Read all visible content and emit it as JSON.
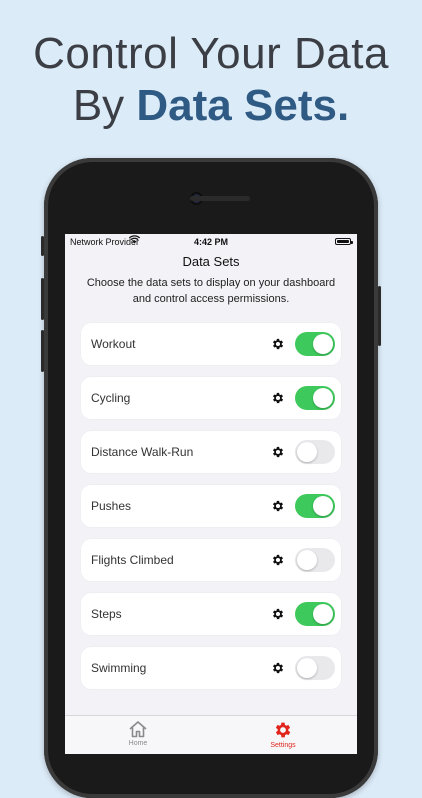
{
  "promo": {
    "line1": "Control Your Data",
    "line2_prefix": "By ",
    "line2_accent": "Data Sets."
  },
  "status_bar": {
    "carrier": "Network Provider",
    "time": "4:42 PM"
  },
  "screen": {
    "title": "Data Sets",
    "description": "Choose the data sets to display on your dashboard and control access permissions."
  },
  "data_sets": [
    {
      "label": "Workout",
      "enabled": true
    },
    {
      "label": "Cycling",
      "enabled": true
    },
    {
      "label": "Distance Walk-Run",
      "enabled": false
    },
    {
      "label": "Pushes",
      "enabled": true
    },
    {
      "label": "Flights Climbed",
      "enabled": false
    },
    {
      "label": "Steps",
      "enabled": true
    },
    {
      "label": "Swimming",
      "enabled": false
    }
  ],
  "tab_bar": {
    "home_label": "Home",
    "settings_label": "Settings",
    "selected": "settings"
  },
  "colors": {
    "background": "#dcebf8",
    "accent_text": "#2f5a84",
    "toggle_on": "#3ec95c",
    "toggle_off": "#e9e9ec",
    "tab_active": "#e0261c"
  }
}
